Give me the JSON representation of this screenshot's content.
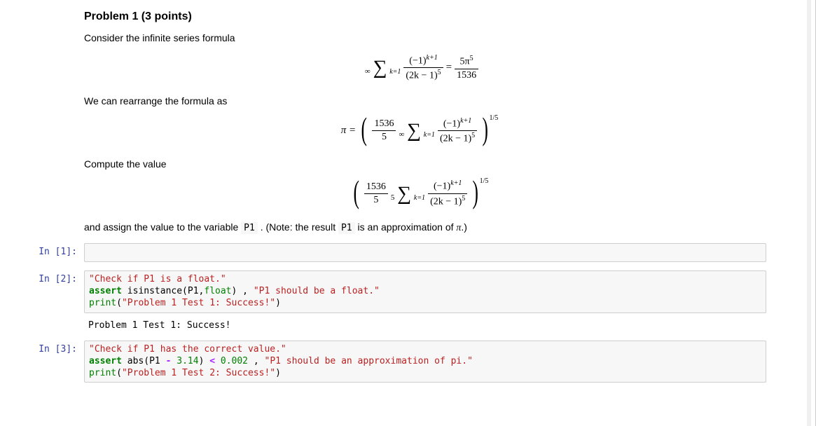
{
  "markdown": {
    "heading": "Problem 1 (3 points)",
    "p1": "Consider the infinite series formula",
    "p2": "We can rearrange the formula as",
    "p3": "Compute the value",
    "p4_prefix": "and assign the value to the variable ",
    "p4_code1": "P1",
    "p4_mid": " . (Note: the result ",
    "p4_code2": "P1",
    "p4_tail1": " is an approximation of ",
    "p4_pi": "π",
    "p4_tail2": ".)"
  },
  "formulas": {
    "f1": {
      "sum_top": "∞",
      "sum_bot": "k=1",
      "term_num": "(−1)",
      "term_num_exp": "k+1",
      "term_den_base": "(2k − 1)",
      "term_den_exp": "5",
      "equals": "=",
      "rhs_num": "5π",
      "rhs_num_exp": "5",
      "rhs_den": "1536"
    },
    "f2": {
      "lhs": "π =",
      "coef_num": "1536",
      "coef_den": "5",
      "sum_top": "∞",
      "sum_bot": "k=1",
      "term_num": "(−1)",
      "term_num_exp": "k+1",
      "term_den_base": "(2k − 1)",
      "term_den_exp": "5",
      "outer_exp": "1/5"
    },
    "f3": {
      "coef_num": "1536",
      "coef_den": "5",
      "sum_top": "5",
      "sum_bot": "k=1",
      "term_num": "(−1)",
      "term_num_exp": "k+1",
      "term_den_base": "(2k − 1)",
      "term_den_exp": "5",
      "outer_exp": "1/5"
    }
  },
  "cells": [
    {
      "prompt": "In [1]:",
      "code_lines": [],
      "output": ""
    },
    {
      "prompt": "In [2]:",
      "code_lines": [
        [
          {
            "c": "c-str",
            "t": "\"Check if P1 is a float.\""
          }
        ],
        [
          {
            "c": "c-kw",
            "t": "assert"
          },
          {
            "c": "",
            "t": " isinstance(P1,"
          },
          {
            "c": "c-bn",
            "t": "float"
          },
          {
            "c": "",
            "t": ") , "
          },
          {
            "c": "c-str",
            "t": "\"P1 should be a float.\""
          }
        ],
        [
          {
            "c": "c-bn",
            "t": "print"
          },
          {
            "c": "",
            "t": "("
          },
          {
            "c": "c-str",
            "t": "\"Problem 1 Test 1: Success!\""
          },
          {
            "c": "",
            "t": ")"
          }
        ]
      ],
      "output": "Problem 1 Test 1: Success!"
    },
    {
      "prompt": "In [3]:",
      "code_lines": [
        [
          {
            "c": "c-str",
            "t": "\"Check if P1 has the correct value.\""
          }
        ],
        [
          {
            "c": "c-kw",
            "t": "assert"
          },
          {
            "c": "",
            "t": " abs(P1 "
          },
          {
            "c": "c-op",
            "t": "-"
          },
          {
            "c": "",
            "t": " "
          },
          {
            "c": "c-num",
            "t": "3.14"
          },
          {
            "c": "",
            "t": ") "
          },
          {
            "c": "c-op",
            "t": "<"
          },
          {
            "c": "",
            "t": " "
          },
          {
            "c": "c-num",
            "t": "0.002"
          },
          {
            "c": "",
            "t": " , "
          },
          {
            "c": "c-str",
            "t": "\"P1 should be an approximation of pi.\""
          }
        ],
        [
          {
            "c": "c-bn",
            "t": "print"
          },
          {
            "c": "",
            "t": "("
          },
          {
            "c": "c-str",
            "t": "\"Problem 1 Test 2: Success!\""
          },
          {
            "c": "",
            "t": ")"
          }
        ]
      ],
      "output": ""
    }
  ]
}
